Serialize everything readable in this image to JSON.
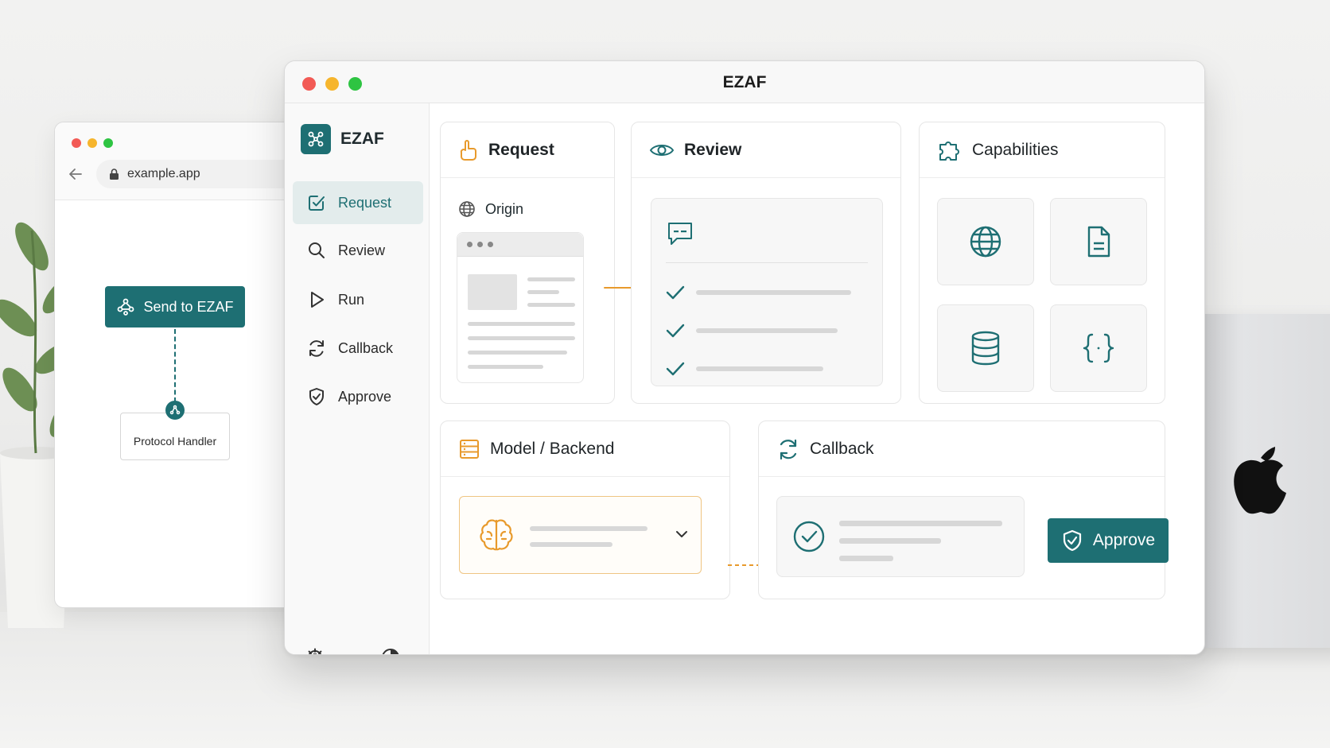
{
  "browser": {
    "url": "example.app",
    "send_button_label": "Send to EZAF",
    "handler_label": "Protocol Handler"
  },
  "window": {
    "title": "EZAF",
    "brand": "EZAF"
  },
  "sidebar": {
    "items": [
      {
        "label": "Request",
        "icon": "request-check-icon",
        "active": true
      },
      {
        "label": "Review",
        "icon": "search-icon",
        "active": false
      },
      {
        "label": "Run",
        "icon": "play-icon",
        "active": false
      },
      {
        "label": "Callback",
        "icon": "refresh-icon",
        "active": false
      },
      {
        "label": "Approve",
        "icon": "shield-check-icon",
        "active": false
      }
    ],
    "footer_icons": [
      "gear-icon",
      "contrast-icon"
    ]
  },
  "cards": {
    "request": {
      "title": "Request",
      "origin_label": "Origin"
    },
    "review": {
      "title": "Review"
    },
    "capabilities": {
      "title": "Capabilities",
      "tiles": [
        "globe-icon",
        "document-icon",
        "database-icon",
        "code-braces-icon"
      ]
    },
    "model": {
      "title": "Model / Backend"
    },
    "callback": {
      "title": "Callback",
      "approve_label": "Approve"
    }
  },
  "colors": {
    "accent": "#1e6f73",
    "orange": "#e89a2c",
    "close": "#f25a55",
    "minimize": "#f6b52d",
    "zoom": "#2ec442"
  }
}
